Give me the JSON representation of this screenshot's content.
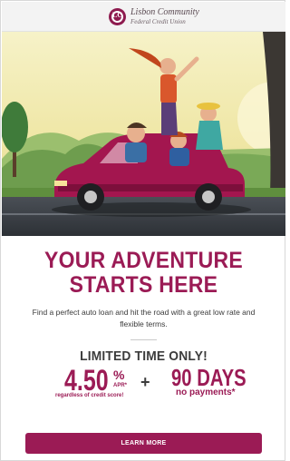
{
  "header": {
    "logo_monogram": "LC",
    "brand_name": "Lisbon Community",
    "brand_subtitle": "Federal Credit Union"
  },
  "hero": {
    "illustration": "family-road-trip-in-red-convertible"
  },
  "promo": {
    "headline_line1": "YOUR ADVENTURE",
    "headline_line2": "STARTS HERE",
    "subcopy": "Find a perfect auto loan and hit the road with a great low rate and flexible terms.",
    "limited_label": "LIMITED TIME ONLY!",
    "rate_value": "4.50",
    "rate_percent": "%",
    "rate_apr": "APR*",
    "rate_disclaimer": "regardless of credit score!",
    "plus_sign": "+",
    "days_value": "90 DAYS",
    "days_caption": "no payments*"
  },
  "cta": {
    "label": "LEARN MORE"
  },
  "colors": {
    "brand": "#9b1b55",
    "header_bg": "#f3f3f3",
    "text_dark": "#3c3c3c"
  }
}
